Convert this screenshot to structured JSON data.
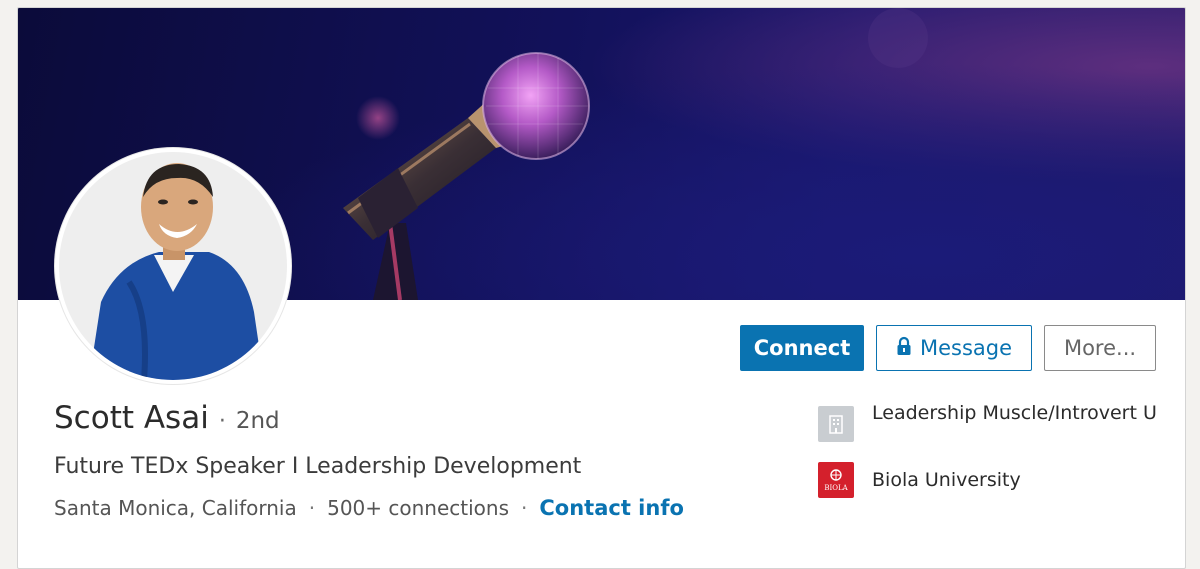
{
  "profile": {
    "name": "Scott Asai",
    "degree": "2nd",
    "name_separator": "·",
    "headline": "Future TEDx Speaker I Leadership Development",
    "location": "Santa Monica, California",
    "connections": "500+ connections",
    "contact_info": "Contact info"
  },
  "actions": {
    "connect": "Connect",
    "message": "Message",
    "more": "More..."
  },
  "experience": [
    {
      "name": "Leadership Muscle/Introvert U",
      "icon": "company-building-icon"
    },
    {
      "name": "Biola University",
      "icon": "biola-logo",
      "logo_text": "BIOLA"
    }
  ],
  "colors": {
    "primary": "#0a73b1",
    "banner": "#12115a",
    "biola_red": "#d4202c"
  }
}
